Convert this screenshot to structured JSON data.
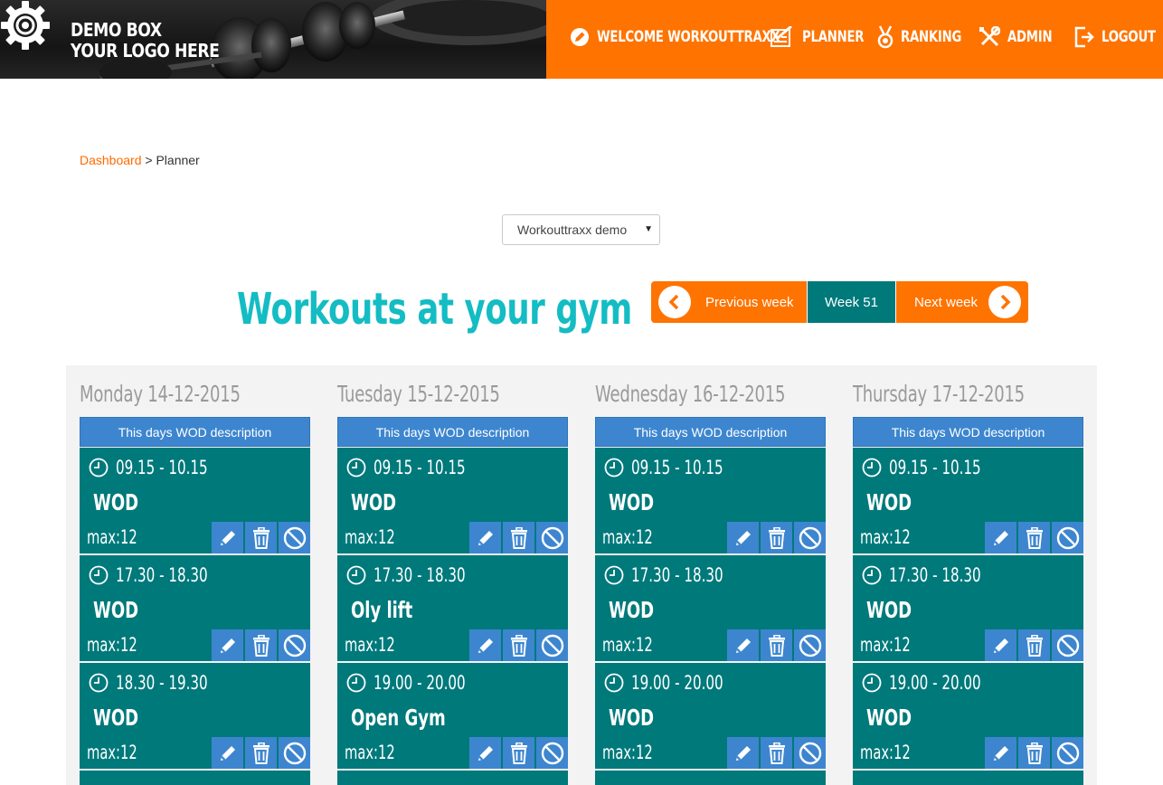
{
  "branding": {
    "line1": "DEMO BOX",
    "line2": "YOUR LOGO HERE",
    "logo_icon": "gear-logo-icon"
  },
  "nav": [
    {
      "label": "WELCOME WORKOUTTRAXX",
      "icon": "pencil-circle-icon"
    },
    {
      "label": "PLANNER",
      "icon": "checklist-icon"
    },
    {
      "label": "RANKING",
      "icon": "medal-icon"
    },
    {
      "label": "ADMIN",
      "icon": "tools-icon"
    },
    {
      "label": "LOGOUT",
      "icon": "logout-icon"
    }
  ],
  "breadcrumb": {
    "home": "Dashboard",
    "separator": ">",
    "current": "Planner"
  },
  "gym_select": {
    "value": "Workouttraxx demo"
  },
  "page_title": "Workouts at your gym",
  "week_nav": {
    "prev": "Previous week",
    "current": "Week 51",
    "next": "Next week"
  },
  "colors": {
    "orange": "#ff7300",
    "teal": "#00797b",
    "blue": "#3d86cf",
    "title": "#14bcc3"
  },
  "days": [
    {
      "title": "Monday 14-12-2015",
      "wod_desc": "This days WOD description",
      "sessions": [
        {
          "time": "09.15 - 10.15",
          "name": "WOD",
          "max": "max:12"
        },
        {
          "time": "17.30 - 18.30",
          "name": "WOD",
          "max": "max:12"
        },
        {
          "time": "18.30 - 19.30",
          "name": "WOD",
          "max": "max:12"
        }
      ]
    },
    {
      "title": "Tuesday 15-12-2015",
      "wod_desc": "This days WOD description",
      "sessions": [
        {
          "time": "09.15 - 10.15",
          "name": "WOD",
          "max": "max:12"
        },
        {
          "time": "17.30 - 18.30",
          "name": "Oly lift",
          "max": "max:12"
        },
        {
          "time": "19.00 - 20.00",
          "name": "Open Gym",
          "max": "max:12"
        }
      ]
    },
    {
      "title": "Wednesday 16-12-2015",
      "wod_desc": "This days WOD description",
      "sessions": [
        {
          "time": "09.15 - 10.15",
          "name": "WOD",
          "max": "max:12"
        },
        {
          "time": "17.30 - 18.30",
          "name": "WOD",
          "max": "max:12"
        },
        {
          "time": "19.00 - 20.00",
          "name": "WOD",
          "max": "max:12"
        }
      ]
    },
    {
      "title": "Thursday 17-12-2015",
      "wod_desc": "This days WOD description",
      "sessions": [
        {
          "time": "09.15 - 10.15",
          "name": "WOD",
          "max": "max:12"
        },
        {
          "time": "17.30 - 18.30",
          "name": "WOD",
          "max": "max:12"
        },
        {
          "time": "19.00 - 20.00",
          "name": "WOD",
          "max": "max:12"
        }
      ]
    }
  ]
}
